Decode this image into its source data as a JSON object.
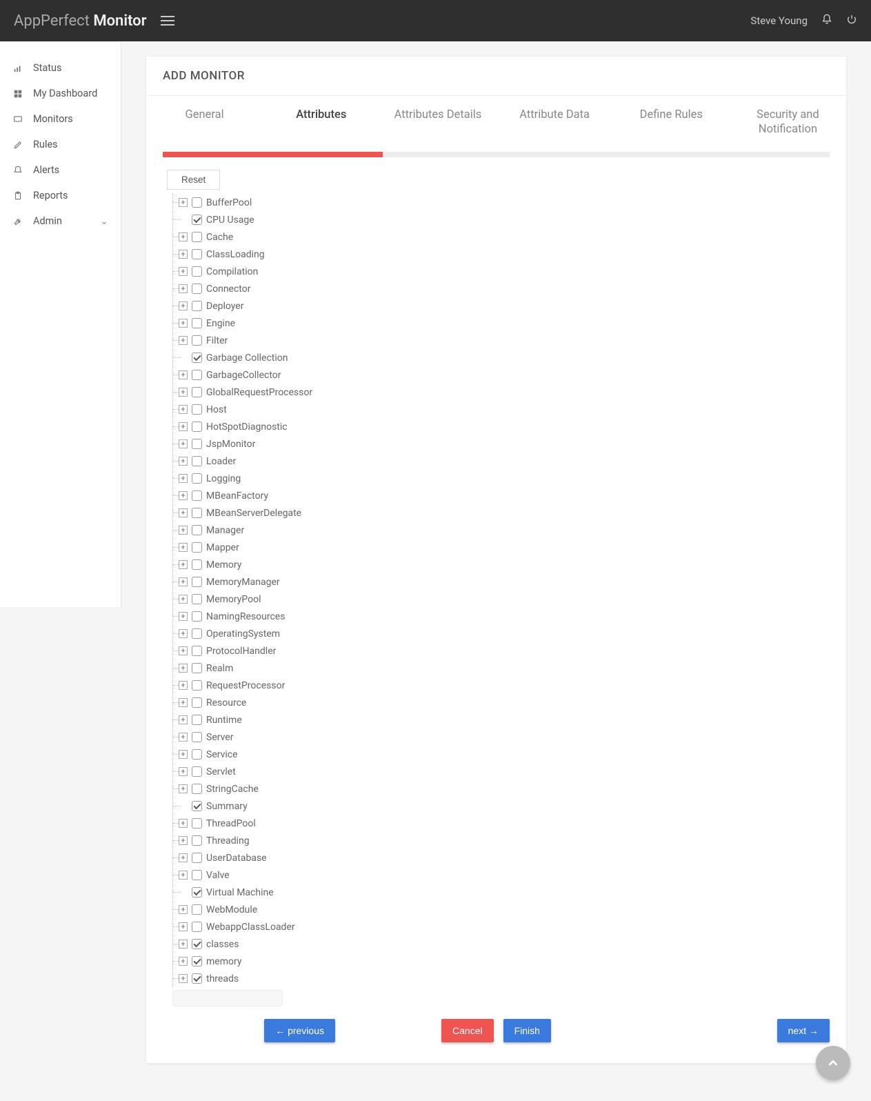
{
  "brand": {
    "light": "AppPerfect",
    "bold": "Monitor"
  },
  "user_name": "Steve Young",
  "sidebar": {
    "items": [
      {
        "label": "Status",
        "icon": "bars"
      },
      {
        "label": "My Dashboard",
        "icon": "grid"
      },
      {
        "label": "Monitors",
        "icon": "display"
      },
      {
        "label": "Rules",
        "icon": "pencil"
      },
      {
        "label": "Alerts",
        "icon": "bell"
      },
      {
        "label": "Reports",
        "icon": "clipboard"
      },
      {
        "label": "Admin",
        "icon": "wrench",
        "chevron": true
      }
    ]
  },
  "page_title": "ADD MONITOR",
  "tabs": [
    {
      "label": "General"
    },
    {
      "label": "Attributes",
      "active": true
    },
    {
      "label": "Attributes Details"
    },
    {
      "label": "Attribute Data"
    },
    {
      "label": "Define Rules"
    },
    {
      "label": "Security and Notification"
    }
  ],
  "progress_percent": 33,
  "reset_label": "Reset",
  "tree": [
    {
      "label": "BufferPool",
      "expandable": true,
      "checked": false
    },
    {
      "label": "CPU Usage",
      "expandable": false,
      "checked": true
    },
    {
      "label": "Cache",
      "expandable": true,
      "checked": false
    },
    {
      "label": "ClassLoading",
      "expandable": true,
      "checked": false
    },
    {
      "label": "Compilation",
      "expandable": true,
      "checked": false
    },
    {
      "label": "Connector",
      "expandable": true,
      "checked": false
    },
    {
      "label": "Deployer",
      "expandable": true,
      "checked": false
    },
    {
      "label": "Engine",
      "expandable": true,
      "checked": false
    },
    {
      "label": "Filter",
      "expandable": true,
      "checked": false
    },
    {
      "label": "Garbage Collection",
      "expandable": false,
      "checked": true
    },
    {
      "label": "GarbageCollector",
      "expandable": true,
      "checked": false
    },
    {
      "label": "GlobalRequestProcessor",
      "expandable": true,
      "checked": false
    },
    {
      "label": "Host",
      "expandable": true,
      "checked": false
    },
    {
      "label": "HotSpotDiagnostic",
      "expandable": true,
      "checked": false
    },
    {
      "label": "JspMonitor",
      "expandable": true,
      "checked": false
    },
    {
      "label": "Loader",
      "expandable": true,
      "checked": false
    },
    {
      "label": "Logging",
      "expandable": true,
      "checked": false
    },
    {
      "label": "MBeanFactory",
      "expandable": true,
      "checked": false
    },
    {
      "label": "MBeanServerDelegate",
      "expandable": true,
      "checked": false
    },
    {
      "label": "Manager",
      "expandable": true,
      "checked": false
    },
    {
      "label": "Mapper",
      "expandable": true,
      "checked": false
    },
    {
      "label": "Memory",
      "expandable": true,
      "checked": false
    },
    {
      "label": "MemoryManager",
      "expandable": true,
      "checked": false
    },
    {
      "label": "MemoryPool",
      "expandable": true,
      "checked": false
    },
    {
      "label": "NamingResources",
      "expandable": true,
      "checked": false
    },
    {
      "label": "OperatingSystem",
      "expandable": true,
      "checked": false
    },
    {
      "label": "ProtocolHandler",
      "expandable": true,
      "checked": false
    },
    {
      "label": "Realm",
      "expandable": true,
      "checked": false
    },
    {
      "label": "RequestProcessor",
      "expandable": true,
      "checked": false
    },
    {
      "label": "Resource",
      "expandable": true,
      "checked": false
    },
    {
      "label": "Runtime",
      "expandable": true,
      "checked": false
    },
    {
      "label": "Server",
      "expandable": true,
      "checked": false
    },
    {
      "label": "Service",
      "expandable": true,
      "checked": false
    },
    {
      "label": "Servlet",
      "expandable": true,
      "checked": false
    },
    {
      "label": "StringCache",
      "expandable": true,
      "checked": false
    },
    {
      "label": "Summary",
      "expandable": false,
      "checked": true
    },
    {
      "label": "ThreadPool",
      "expandable": true,
      "checked": false
    },
    {
      "label": "Threading",
      "expandable": true,
      "checked": false
    },
    {
      "label": "UserDatabase",
      "expandable": true,
      "checked": false
    },
    {
      "label": "Valve",
      "expandable": true,
      "checked": false
    },
    {
      "label": "Virtual Machine",
      "expandable": false,
      "checked": true
    },
    {
      "label": "WebModule",
      "expandable": true,
      "checked": false
    },
    {
      "label": "WebappClassLoader",
      "expandable": true,
      "checked": false
    },
    {
      "label": "classes",
      "expandable": true,
      "checked": true
    },
    {
      "label": "memory",
      "expandable": true,
      "checked": true
    },
    {
      "label": "threads",
      "expandable": true,
      "checked": true
    }
  ],
  "buttons": {
    "previous": "previous",
    "cancel": "Cancel",
    "finish": "Finish",
    "next": "next"
  }
}
